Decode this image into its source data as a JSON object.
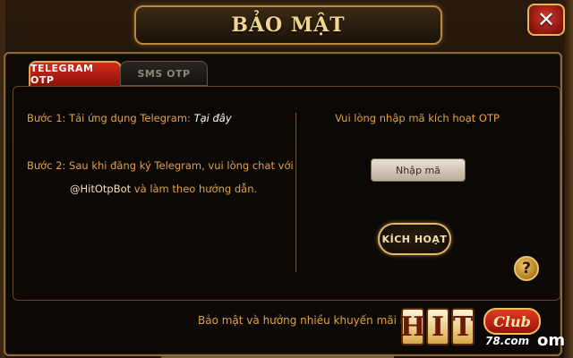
{
  "dialog": {
    "title": "BẢO MẬT",
    "close_icon": "close-x-icon"
  },
  "tabs": [
    {
      "label": "TELEGRAM OTP",
      "active": true
    },
    {
      "label": "SMS OTP",
      "active": false
    }
  ],
  "instructions": {
    "step1_text": "Bước 1: Tải ứng dụng Telegram:",
    "step1_link": "Tại đây",
    "step2_line1": "Bước 2: Sau khi đăng ký Telegram, vui lòng chat với",
    "step2_bot": "@HitOtpBot",
    "step2_line2_rest": " và làm theo hướng dẫn."
  },
  "otp": {
    "label": "Vui lòng nhập mã kích hoạt OTP",
    "placeholder": "Nhập mã",
    "value": "",
    "activate_label": "KÍCH HOẠT",
    "help_label": "?"
  },
  "footer": {
    "promo": "Bảo mật và hưởng nhiều khuyến mãi hơn"
  },
  "logo": {
    "letters": [
      "H",
      "I",
      "T"
    ],
    "club": "Club",
    "domain": "78.com",
    "suffix": "om"
  },
  "colors": {
    "accent_gold": "#e0a441",
    "frame_gold": "#b98a3e",
    "tab_active_red": "#d32b1d",
    "background": "#0b0805"
  }
}
